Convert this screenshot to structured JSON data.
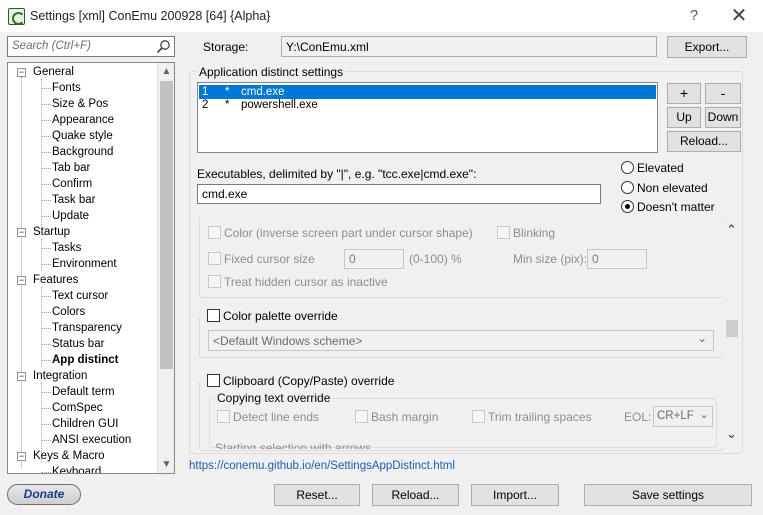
{
  "window": {
    "title": "Settings [xml] ConEmu 200928 [64] {Alpha}",
    "help": "?",
    "close": "✕"
  },
  "search": {
    "placeholder": "Search (Ctrl+F)"
  },
  "tree": {
    "general": "General",
    "fonts": "Fonts",
    "size_pos": "Size & Pos",
    "appearance": "Appearance",
    "quake": "Quake style",
    "background": "Background",
    "tabbar": "Tab bar",
    "confirm": "Confirm",
    "taskbar": "Task bar",
    "update": "Update",
    "startup": "Startup",
    "tasks": "Tasks",
    "environment": "Environment",
    "features": "Features",
    "text_cursor": "Text cursor",
    "colors": "Colors",
    "transparency": "Transparency",
    "status_bar": "Status bar",
    "app_distinct": "App distinct",
    "integration": "Integration",
    "default_term": "Default term",
    "comspec": "ComSpec",
    "children_gui": "Children GUI",
    "ansi": "ANSI execution",
    "keys_macro": "Keys & Macro",
    "keyboard": "Keyboard",
    "expander_minus": "−",
    "scroll_up": "▲",
    "scroll_down": "▼"
  },
  "storage": {
    "label": "Storage:",
    "value": "Y:\\ConEmu.xml",
    "export": "Export..."
  },
  "apps": {
    "group_label": "Application distinct settings",
    "rows": [
      {
        "num": "1",
        "mark": "*",
        "name": "cmd.exe"
      },
      {
        "num": "2",
        "mark": "*",
        "name": "powershell.exe"
      }
    ],
    "add": "+",
    "remove": "-",
    "up": "Up",
    "down": "Down",
    "reload": "Reload..."
  },
  "executables": {
    "label": "Executables, delimited by \"|\", e.g. \"tcc.exe|cmd.exe\":",
    "value": "cmd.exe"
  },
  "elevation": {
    "elevated": "Elevated",
    "non_elevated": "Non elevated",
    "doesnt_matter": "Doesn't matter",
    "selected": "doesnt_matter"
  },
  "cursor": {
    "color": "Color (inverse screen part under cursor shape)",
    "blinking": "Blinking",
    "fixed_size": "Fixed cursor size",
    "fixed_value": "0",
    "range": "(0-100) %",
    "min_size": "Min size (pix):",
    "min_value": "0",
    "treat_hidden": "Treat hidden cursor as inactive"
  },
  "palette": {
    "override": "Color palette override",
    "scheme": "<Default Windows scheme>"
  },
  "clipboard": {
    "override": "Clipboard (Copy/Paste) override",
    "copying": "Copying text override",
    "detect_line_ends": "Detect line ends",
    "bash_margin": "Bash margin",
    "trim_trailing": "Trim trailing spaces",
    "eol_label": "EOL:",
    "eol_value": "CR+LF",
    "starting_selection": "Starting selection with arrows"
  },
  "link": "https://conemu.github.io/en/SettingsAppDistinct.html",
  "footer": {
    "donate": "Donate",
    "reset": "Reset...",
    "reload": "Reload...",
    "import": "Import...",
    "save": "Save settings"
  },
  "arrows": {
    "up": "⌃",
    "down": "⌄",
    "combo": "⌄"
  }
}
